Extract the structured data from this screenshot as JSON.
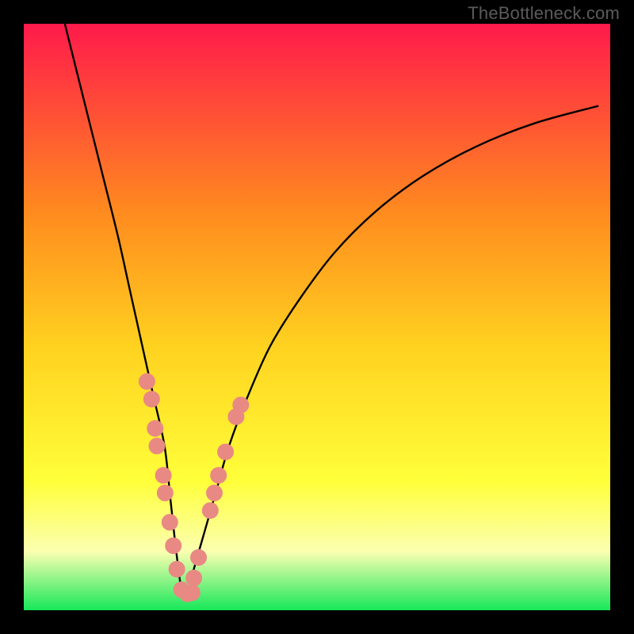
{
  "watermark": "TheBottleneck.com",
  "gradient": {
    "top": "#ff1a4b",
    "upper_mid": "#ff8a1f",
    "mid": "#ffd21f",
    "lower_mid": "#ffff3a",
    "pale_band": "#fbffb0",
    "bottom": "#17e85a"
  },
  "curve_color": "#000000",
  "marker_color": "#e98983",
  "chart_data": {
    "type": "line",
    "title": "",
    "xlabel": "",
    "ylabel": "",
    "xlim": [
      0,
      100
    ],
    "ylim": [
      0,
      100
    ],
    "bottleneck_minimum_x": 27,
    "series": [
      {
        "name": "bottleneck-curve",
        "x": [
          7,
          10,
          13,
          16,
          18,
          20,
          22,
          24,
          25,
          26,
          27,
          28,
          29,
          31,
          33,
          35,
          38,
          42,
          47,
          53,
          60,
          68,
          77,
          87,
          98
        ],
        "y": [
          100,
          88,
          76,
          64,
          55,
          46,
          37,
          28,
          19,
          10,
          3,
          3,
          7,
          14,
          21,
          28,
          36,
          45,
          53,
          61,
          68,
          74,
          79,
          83,
          86
        ]
      }
    ],
    "markers": [
      {
        "x": 21.0,
        "y": 39
      },
      {
        "x": 21.8,
        "y": 36
      },
      {
        "x": 22.4,
        "y": 31
      },
      {
        "x": 22.7,
        "y": 28
      },
      {
        "x": 23.8,
        "y": 23
      },
      {
        "x": 24.1,
        "y": 20
      },
      {
        "x": 24.9,
        "y": 15
      },
      {
        "x": 25.5,
        "y": 11
      },
      {
        "x": 26.1,
        "y": 7
      },
      {
        "x": 26.9,
        "y": 3.5
      },
      {
        "x": 27.9,
        "y": 2.8
      },
      {
        "x": 28.7,
        "y": 3.0
      },
      {
        "x": 29.0,
        "y": 5.5
      },
      {
        "x": 29.8,
        "y": 9
      },
      {
        "x": 31.8,
        "y": 17
      },
      {
        "x": 32.5,
        "y": 20
      },
      {
        "x": 33.2,
        "y": 23
      },
      {
        "x": 34.4,
        "y": 27
      },
      {
        "x": 36.2,
        "y": 33
      },
      {
        "x": 37.0,
        "y": 35
      }
    ]
  }
}
